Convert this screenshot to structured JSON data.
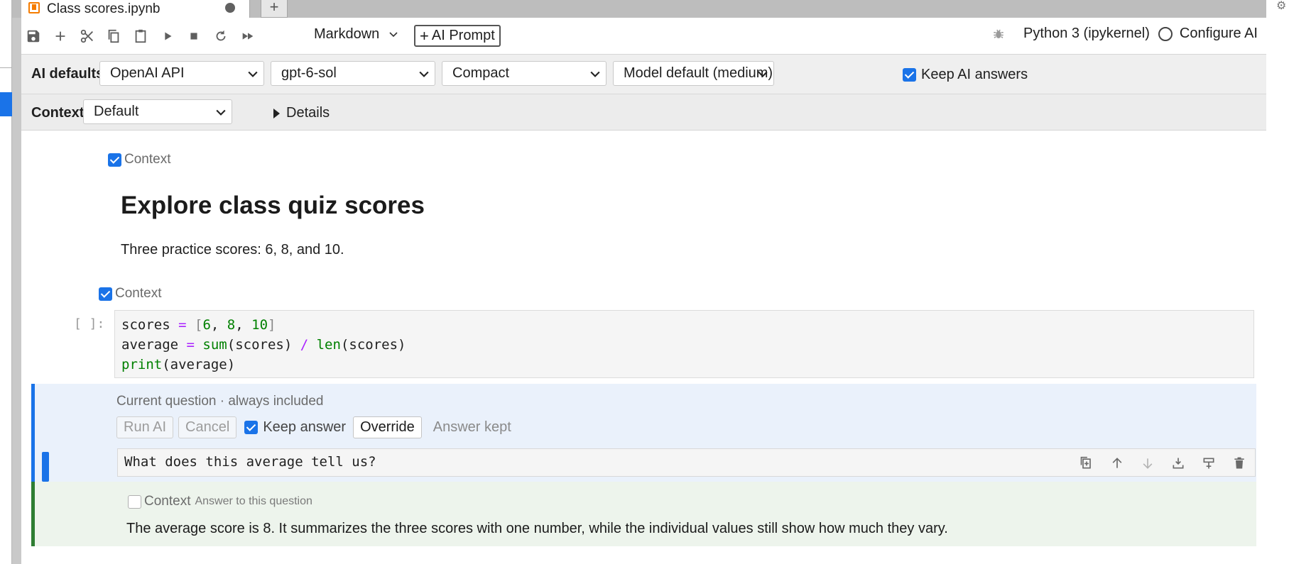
{
  "tab": {
    "title": "Class scores.ipynb",
    "new_tab_label": "+"
  },
  "toolbar": {
    "cell_type": "Markdown",
    "ai_prompt_label": "AI Prompt",
    "kernel_name": "Python 3 (ipykernel)",
    "configure_ai_label": "Configure AI"
  },
  "ai_defaults": {
    "label": "AI defaults",
    "provider": "OpenAI API",
    "model": "gpt-6-sol",
    "style": "Compact",
    "reasoning": "Model default (medium)",
    "keep_answers_label": "Keep AI answers",
    "keep_answers_checked": true
  },
  "context_bar": {
    "label": "Context",
    "value": "Default",
    "details_label": "Details"
  },
  "cells": {
    "markdown": {
      "context_label": "Context",
      "title": "Explore class quiz scores",
      "text": "Three practice scores: 6, 8, and 10."
    },
    "code": {
      "context_label": "Context",
      "prompt": "[ ]:",
      "line1": {
        "a": "scores ",
        "op": "=",
        "b": " ",
        "lb": "[",
        "n1": "6",
        "c1": ", ",
        "n2": "8",
        "c2": ", ",
        "n3": "10",
        "rb": "]"
      },
      "line2": {
        "a": "average ",
        "op": "=",
        "b": " ",
        "fn1": "sum",
        "args1": "(scores) ",
        "op2": "/",
        "c": " ",
        "fn2": "len",
        "args2": "(scores)"
      },
      "line3": {
        "fn": "print",
        "args": "(average)"
      }
    },
    "question": {
      "subtitle": "Current question · always included",
      "run_label": "Run AI",
      "cancel_label": "Cancel",
      "keep_answer_label": "Keep answer",
      "override_label": "Override",
      "status": "Answer kept",
      "text": "What does this average tell us?"
    },
    "answer": {
      "context_label": "Context",
      "context_sub": "Answer to this question",
      "text": "The average score is 8. It summarizes the three scores with one number, while the individual values still show how much they vary."
    }
  },
  "colors": {
    "accent": "#1a73e8",
    "answer_border": "#2e7d32",
    "tab_icon": "#f57c00"
  }
}
